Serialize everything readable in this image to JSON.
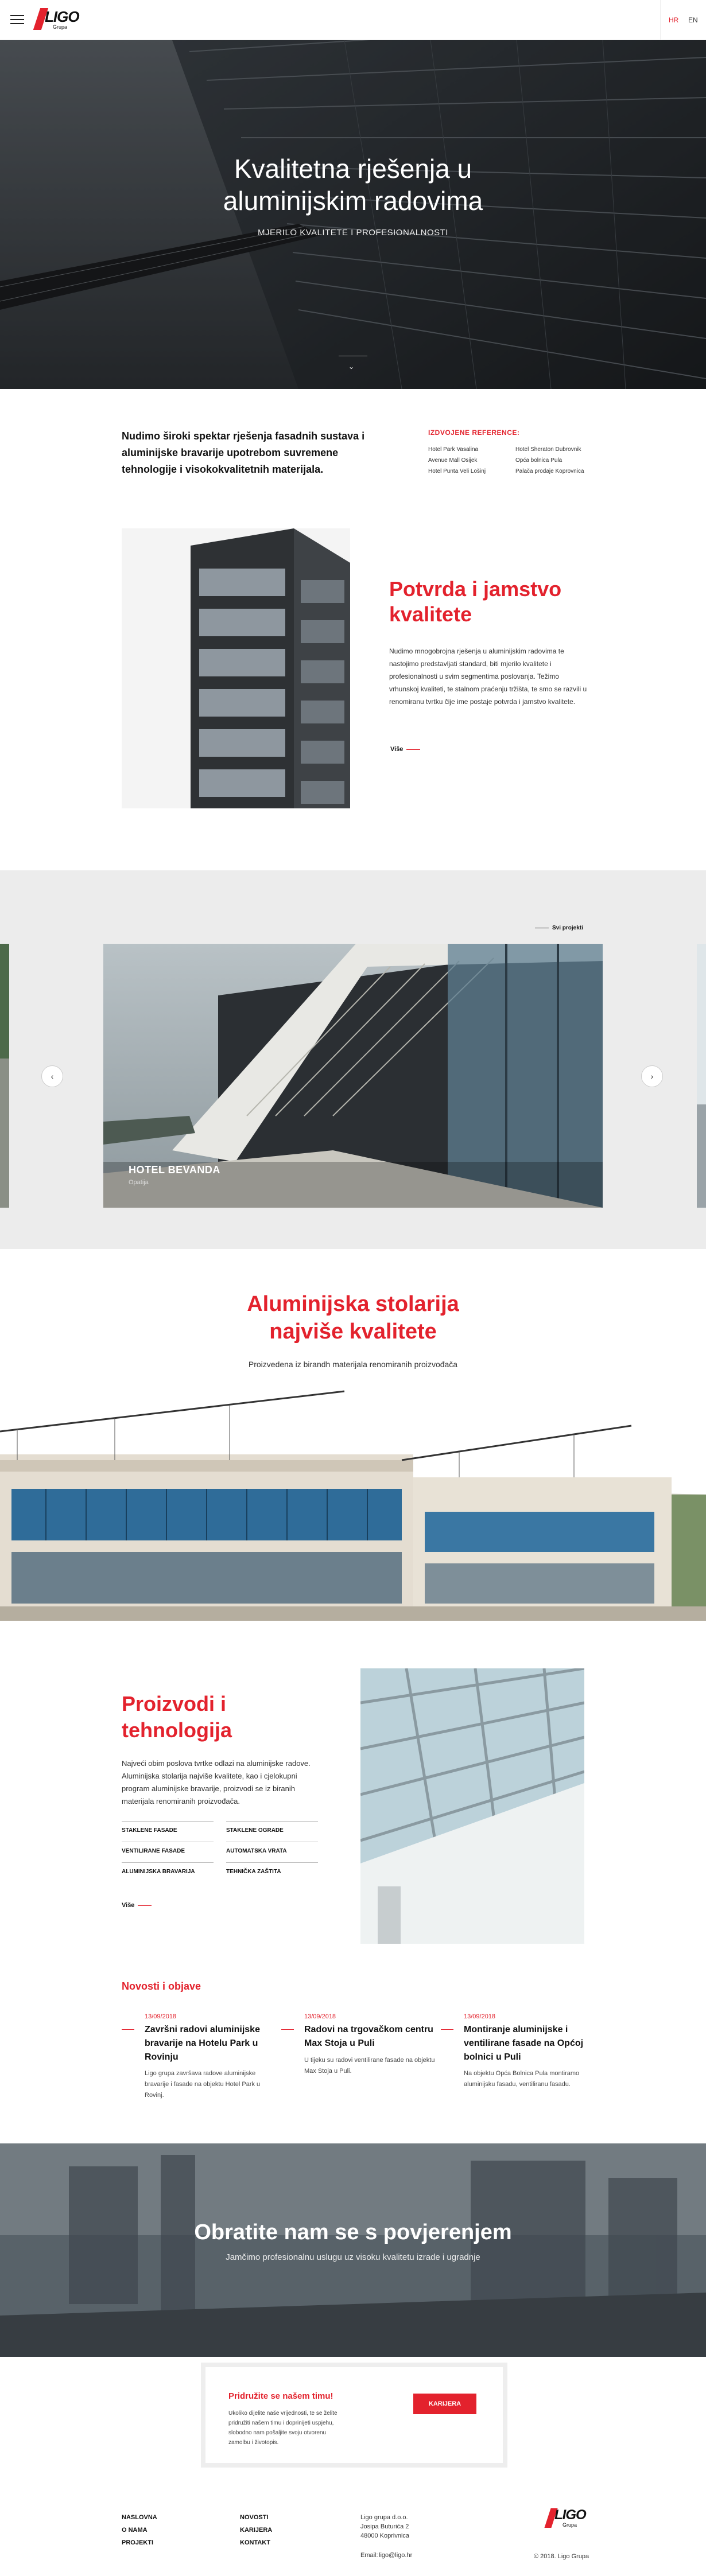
{
  "header": {
    "logo_text": "LIGO",
    "logo_sub": "Grupa",
    "languages": [
      "HR",
      "EN"
    ],
    "active_language": "HR"
  },
  "hero": {
    "title_line1": "Kvalitetna rješenja u",
    "title_line2": "aluminijskim radovima",
    "subtitle": "MJERILO KVALITETE I PROFESIONALNOSTI"
  },
  "intro": {
    "text": "Nudimo široki spektar rješenja fasadnih sustava i aluminijske bravarije upotrebom suvremene tehnologije i visokokvalitetnih materijala.",
    "references_title": "IZDVOJENE REFERENCE:",
    "references": [
      {
        "label": "Hotel Park Vasalina",
        "highlight": true
      },
      {
        "label": "Hotel Sheraton Dubrovnik",
        "highlight": false
      },
      {
        "label": "Avenue Mall Osijek",
        "highlight": true
      },
      {
        "label": "Opća bolnica Pula",
        "highlight": false
      },
      {
        "label": "Hotel Punta Veli Lošinj",
        "highlight": false
      },
      {
        "label": "Palača prodaje Koprovnica",
        "highlight": true
      }
    ]
  },
  "quality": {
    "title": "Potvrda i jamstvo kvalitete",
    "text": "Nudimo mnogobrojna rješenja u aluminijskim radovima te nastojimo predstavljati standard, biti mjerilo kvalitete i profesionalnosti u svim segmentima poslovanja. Težimo vrhunskoj kvaliteti, te stalnom praćenju tržišta, te smo se razvili u renomiranu tvrtku čije ime postaje potvrda i jamstvo kvalitete.",
    "more_label": "Više"
  },
  "projects": {
    "all_label": "Svi projekti",
    "current_name": "HOTEL BEVANDA",
    "current_location": "Opatija",
    "prev_icon": "‹",
    "next_icon": "›"
  },
  "windows": {
    "title_line1": "Aluminijska stolarija",
    "title_line2": "najviše kvalitete",
    "subtitle": "Proizvedena iz birandh materijala renomiranih proizvođača"
  },
  "products": {
    "title": "Proizvodi i tehnologija",
    "text": "Najveći obim poslova tvrtke odlazi na aluminijske radove. Aluminijska stolarija najviše kvalitete, kao i cjelokupni program aluminijske bravarije, proizvodi se iz biranih materijala renomiranih proizvođača.",
    "links": [
      "STAKLENE FASADE",
      "STAKLENE OGRADE",
      "VENTILIRANE FASADE",
      "AUTOMATSKA VRATA",
      "ALUMINIJSKA BRAVARIJA",
      "TEHNIČKA ZAŠTITA"
    ],
    "more_label": "Više"
  },
  "news": {
    "title": "Novosti i objave",
    "items": [
      {
        "date": "13/09/2018",
        "title": "Završni radovi aluminijske bravarije na Hotelu Park u Rovinju",
        "text": "Ligo grupa završava radove aluminijske bravarije i fasade na objektu Hotel Park u Rovinj."
      },
      {
        "date": "13/09/2018",
        "title": "Radovi na trgovačkom centru Max Stoja u Puli",
        "text": "U tijeku su radovi ventilirane fasade na objektu Max Stoja u Puli."
      },
      {
        "date": "13/09/2018",
        "title": "Montiranje aluminijske i ventilirane fasade na Općoj bolnici u Puli",
        "text": "Na objektu Opća Bolnica Pula montiramo aluminijsku fasadu, ventiliranu fasadu."
      }
    ]
  },
  "contact": {
    "title": "Obratite nam se s povjerenjem",
    "subtitle": "Jamčimo profesionalnu uslugu uz visoku kvalitetu izrade i ugradnje"
  },
  "join": {
    "title": "Pridružite se našem timu!",
    "text": "Ukoliko dijelite naše vrijednosti, te se želite pridružiti našem timu i doprinijeti uspjehu, slobodno nam pošaljite svoju otvorenu zamolbu i životopis.",
    "button": "KARIJERA"
  },
  "footer": {
    "col1": [
      "NASLOVNA",
      "O NAMA",
      "PROJEKTI"
    ],
    "col2": [
      "NOVOSTI",
      "KARIJERA",
      "KONTAKT"
    ],
    "company": "Ligo grupa d.o.o.",
    "address1": "Josipa Buturića 2",
    "address2": "48000 Koprivnica",
    "email_label": "Email:",
    "email": "ligo@ligo.hr",
    "copyright": "© 2018. Ligo Grupa",
    "logo_text": "LIGO",
    "logo_sub": "Grupa"
  },
  "colors": {
    "accent": "#e3222d",
    "dark": "#111111",
    "light_bg": "#ececec"
  }
}
